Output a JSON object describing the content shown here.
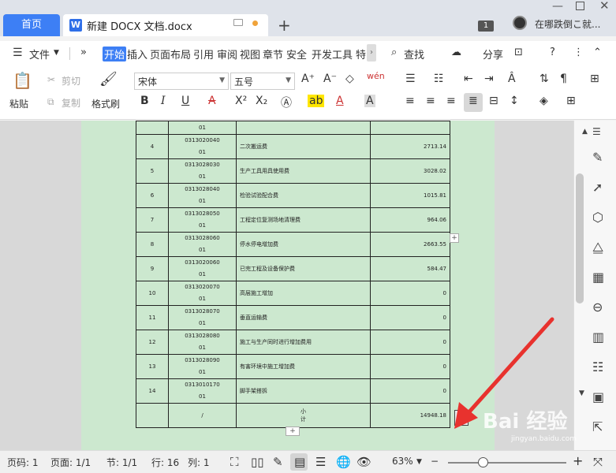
{
  "titlebar": {
    "home_tab": "首页",
    "doc_tab": "新建 DOCX 文档.docx",
    "new_tab": "+",
    "window_count": "1",
    "user_name": "在哪跌倒こ就..."
  },
  "menubar": {
    "file": "文件",
    "more": "»",
    "tabs": [
      "开始",
      "插入",
      "页面布局",
      "引用",
      "审阅",
      "视图",
      "章节",
      "安全",
      "开发工具",
      "特"
    ],
    "search": "查找",
    "share": "分享"
  },
  "toolbar": {
    "paste": "粘贴",
    "cut": "剪切",
    "copy": "复制",
    "format_painter": "格式刷",
    "font_family": "宋体",
    "font_size": "五号"
  },
  "table": {
    "rows": [
      {
        "no": "",
        "code": "01",
        "name": "",
        "amount": ""
      },
      {
        "no": "4",
        "code": "0313020040\n01",
        "name": "二次搬运费",
        "amount": "2713.14"
      },
      {
        "no": "5",
        "code": "0313028030\n01",
        "name": "生产工具用具使用费",
        "amount": "3028.02"
      },
      {
        "no": "6",
        "code": "0313028040\n01",
        "name": "检验试验配合费",
        "amount": "1015.81"
      },
      {
        "no": "7",
        "code": "0313028050\n01",
        "name": "工程定位复测场地清理费",
        "amount": "964.06"
      },
      {
        "no": "8",
        "code": "0313028060\n01",
        "name": "停水停电增加费",
        "amount": "2663.55"
      },
      {
        "no": "9",
        "code": "0313020060\n01",
        "name": "已完工程及设备保护费",
        "amount": "584.47"
      },
      {
        "no": "10",
        "code": "0313020070\n01",
        "name": "高层施工增加",
        "amount": "0"
      },
      {
        "no": "11",
        "code": "0313028070\n01",
        "name": "垂直运输费",
        "amount": "0"
      },
      {
        "no": "12",
        "code": "0313028080\n01",
        "name": "施工与生产同时进行增加费用",
        "amount": "0"
      },
      {
        "no": "13",
        "code": "0313028090\n01",
        "name": "有害环境中施工增加费",
        "amount": "0"
      },
      {
        "no": "14",
        "code": "0313010170\n01",
        "name": "脚手架搭拆",
        "amount": "0"
      },
      {
        "no": "",
        "code": "/",
        "name": "小\n计",
        "amount": "14948.18"
      }
    ]
  },
  "statusbar": {
    "page_num": "页码: 1",
    "pages": "页面: 1/1",
    "section": "节: 1/1",
    "row": "行: 16",
    "col": "列: 1",
    "zoom": "63%",
    "zoom_minus": "−",
    "zoom_plus": "+"
  },
  "watermark": {
    "text": "Bai 经验",
    "url": "jingyan.baidu.com"
  },
  "colors": {
    "accent": "#3d7ff5",
    "page_bg": "#cce8cf",
    "arrow": "#e8322e"
  }
}
